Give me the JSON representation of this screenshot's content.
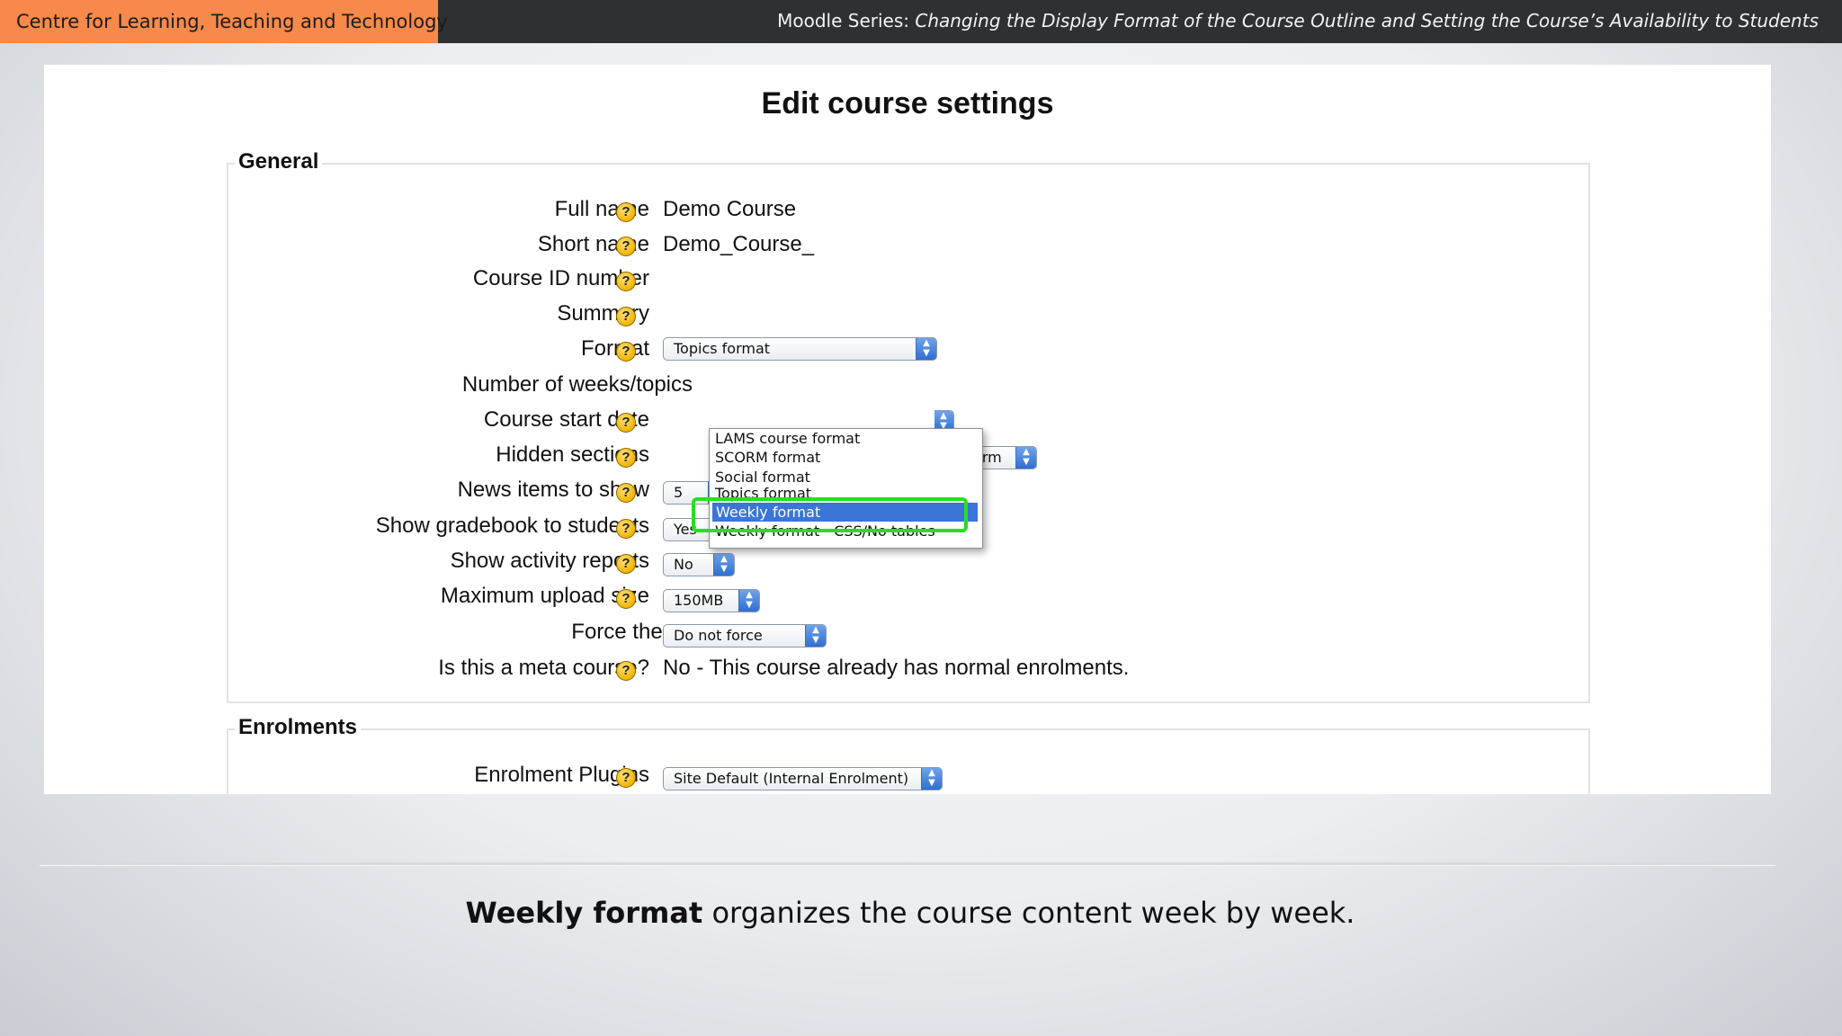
{
  "header": {
    "org": "Centre for Learning, Teaching and Technology",
    "series_prefix": "Moodle Series:",
    "series_title": "Changing the Display Format of the Course Outline and Setting the Course’s Availability to Students"
  },
  "page": {
    "title": "Edit course settings"
  },
  "general": {
    "legend": "General",
    "fields": {
      "full_name": {
        "label": "Full name",
        "value": "Demo Course"
      },
      "short_name": {
        "label": "Short name",
        "value": "Demo_Course_"
      },
      "course_id": {
        "label": "Course ID number"
      },
      "summary": {
        "label": "Summary"
      },
      "format": {
        "label": "Format",
        "value": "Topics format"
      },
      "num_weeks": {
        "label": "Number of weeks/topics"
      },
      "start_date": {
        "label": "Course start date"
      },
      "hidden_sections": {
        "label": "Hidden sections",
        "value": "sed form"
      },
      "news_items": {
        "label": "News items to show",
        "value": "5"
      },
      "gradebook": {
        "label": "Show gradebook to students",
        "value": "Yes"
      },
      "activity_reports": {
        "label": "Show activity reports",
        "value": "No"
      },
      "max_upload": {
        "label": "Maximum upload size",
        "value": "150MB"
      },
      "force_theme": {
        "label": "Force theme",
        "value": "Do not force"
      },
      "meta_course": {
        "label": "Is this a meta course?",
        "value": "No - This course already has normal enrolments."
      }
    }
  },
  "format_dropdown": {
    "options": [
      "LAMS course format",
      "SCORM format",
      "Social format",
      "Topics format",
      "Weekly format",
      "Weekly format - CSS/No tables"
    ],
    "selected": "Weekly format"
  },
  "enrolments": {
    "legend": "Enrolments",
    "plugins": {
      "label": "Enrolment Plugins",
      "value": "Site Default (Internal Enrolment)"
    }
  },
  "caption": {
    "bold": "Weekly format",
    "rest": " organizes the course content week by week."
  },
  "help_glyph": "?",
  "colors": {
    "header_bg": "#2e3031",
    "org_bg": "#f7894a",
    "highlight": "#26e01f",
    "selection": "#3a75d7"
  }
}
